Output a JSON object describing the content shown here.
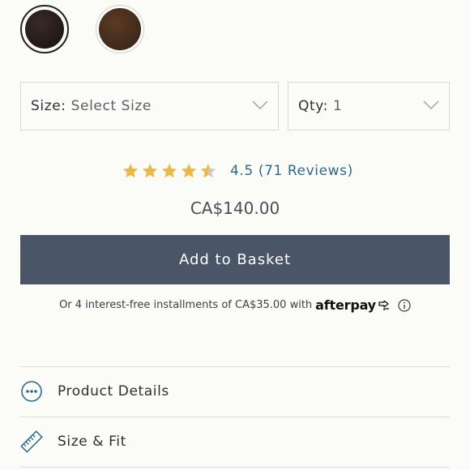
{
  "swatches": [
    {
      "name": "swatch-black",
      "color": "#241b18",
      "selected": true
    },
    {
      "name": "swatch-brown",
      "color": "#432b1c",
      "selected": false
    }
  ],
  "size_select": {
    "label": "Size:",
    "value": "Select Size"
  },
  "qty_select": {
    "label": "Qty:",
    "value": "1"
  },
  "rating": {
    "stars": 4.5,
    "text": "4.5 (71 Reviews)",
    "star_color": "#e9b949"
  },
  "price": "CA$140.00",
  "add_to_basket": "Add to Basket",
  "afterpay": {
    "text": "Or 4 interest-free installments of CA$35.00 with",
    "brand": "afterpay"
  },
  "accordion": [
    {
      "label": "Product Details",
      "icon": "ellipsis-circle-icon"
    },
    {
      "label": "Size & Fit",
      "icon": "ruler-icon"
    }
  ],
  "colors": {
    "button": "#4a5567",
    "link": "#2f6a8d",
    "icon_blue": "#2f6a8d"
  }
}
